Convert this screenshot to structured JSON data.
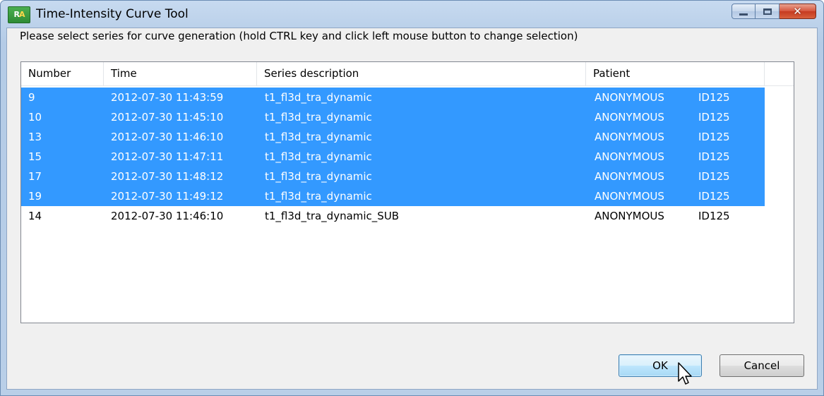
{
  "window": {
    "title": "Time-Intensity Curve Tool",
    "icon_text_left": "R",
    "icon_text_right": "A"
  },
  "caption_buttons": {
    "minimize_icon": "minimize-icon",
    "maximize_icon": "maximize-icon",
    "close_glyph": "✕"
  },
  "instruction": "Please select series for curve generation (hold CTRL key and click left mouse button to change selection)",
  "table": {
    "columns": [
      "Number",
      "Time",
      "Series description",
      "Patient"
    ],
    "rows": [
      {
        "number": "9",
        "time": "2012-07-30 11:43:59",
        "description": "t1_fl3d_tra_dynamic",
        "patient": "ANONYMOUS",
        "id": "ID125",
        "selected": true
      },
      {
        "number": "10",
        "time": "2012-07-30 11:45:10",
        "description": "t1_fl3d_tra_dynamic",
        "patient": "ANONYMOUS",
        "id": "ID125",
        "selected": true
      },
      {
        "number": "13",
        "time": "2012-07-30 11:46:10",
        "description": "t1_fl3d_tra_dynamic",
        "patient": "ANONYMOUS",
        "id": "ID125",
        "selected": true
      },
      {
        "number": "15",
        "time": "2012-07-30 11:47:11",
        "description": "t1_fl3d_tra_dynamic",
        "patient": "ANONYMOUS",
        "id": "ID125",
        "selected": true
      },
      {
        "number": "17",
        "time": "2012-07-30 11:48:12",
        "description": "t1_fl3d_tra_dynamic",
        "patient": "ANONYMOUS",
        "id": "ID125",
        "selected": true
      },
      {
        "number": "19",
        "time": "2012-07-30 11:49:12",
        "description": "t1_fl3d_tra_dynamic",
        "patient": "ANONYMOUS",
        "id": "ID125",
        "selected": true
      },
      {
        "number": "14",
        "time": "2012-07-30 11:46:10",
        "description": "t1_fl3d_tra_dynamic_SUB",
        "patient": "ANONYMOUS",
        "id": "ID125",
        "selected": false
      }
    ]
  },
  "buttons": {
    "ok": "OK",
    "cancel": "Cancel"
  },
  "colors": {
    "selection": "#3399ff",
    "titlebar": "#b9cfe8"
  }
}
